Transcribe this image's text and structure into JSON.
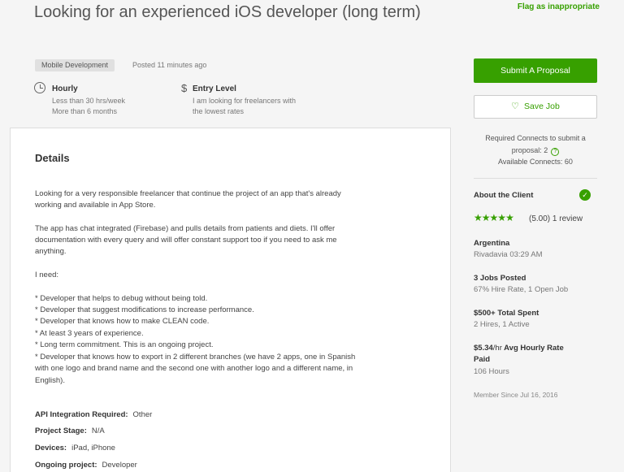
{
  "job": {
    "title": "Looking for an experienced iOS developer (long term)",
    "flag_label": "Flag as inappropriate",
    "category": "Mobile Development",
    "posted": "Posted 11 minutes ago",
    "meta": {
      "rate_type": "Hourly",
      "rate_detail_1": "Less than 30 hrs/week",
      "rate_detail_2": "More than 6 months",
      "level_symbol": "$",
      "level": "Entry Level",
      "level_detail_1": "I am looking for freelancers with",
      "level_detail_2": "the lowest rates"
    }
  },
  "details": {
    "heading": "Details",
    "paragraph_1_line_1": "Looking for a very responsible freelancer that continue the project of an app that's already",
    "paragraph_1_line_2": "working and available in App Store.",
    "paragraph_2_line_1": "The app has chat integrated (Firebase) and pulls details from patients and diets. I'll offer",
    "paragraph_2_line_2": "documentation with every query and will offer constant support too if you need to ask me",
    "paragraph_2_line_3": "anything.",
    "need_label": "I need:",
    "needs": [
      "* Developer that helps to debug without being told.",
      "* Developer that suggest modifications to increase performance.",
      "* Developer that knows how to make CLEAN code.",
      "* At least 3 years of experience.",
      "* Long term commitment. This is an ongoing project.",
      "* Developer that knows how to export in 2 different branches (we have 2 apps, one in Spanish",
      "with one logo and brand name and the second one with another logo and a different name, in",
      "English)."
    ],
    "fields": [
      {
        "label": "API Integration Required:",
        "value": "Other"
      },
      {
        "label": "Project Stage:",
        "value": "N/A"
      },
      {
        "label": "Devices:",
        "value": "iPad, iPhone"
      },
      {
        "label": "Ongoing project:",
        "value": "Developer"
      }
    ]
  },
  "sidebar": {
    "submit_label": "Submit A Proposal",
    "save_label": "Save Job",
    "connects_line_1": "Required Connects to submit a",
    "connects_line_2": "proposal: 2",
    "connects_line_3": "Available Connects: 60",
    "help_symbol": "?",
    "about_client": "About the Client",
    "rating": 5,
    "rating_text": "(5.00) 1 review",
    "country": "Argentina",
    "location": "Rivadavia 03:29 AM",
    "jobs_posted": "3 Jobs Posted",
    "hire_rate": "67% Hire Rate, 1 Open Job",
    "total_spent": "$500+ Total Spent",
    "hires": "2 Hires, 1 Active",
    "avg_rate_value": "$5.34",
    "avg_rate_unit": "/hr",
    "avg_rate_label_1": "Avg Hourly Rate",
    "avg_rate_label_2": "Paid",
    "hours": "106 Hours",
    "member_since": "Member Since Jul 16, 2016"
  },
  "colors": {
    "accent": "#37a000",
    "background": "#f5f5f5",
    "card": "#ffffff"
  },
  "icons": [
    "clock-icon",
    "dollar-icon",
    "heart-icon",
    "help-icon",
    "verified-check-icon",
    "star-icon"
  ]
}
